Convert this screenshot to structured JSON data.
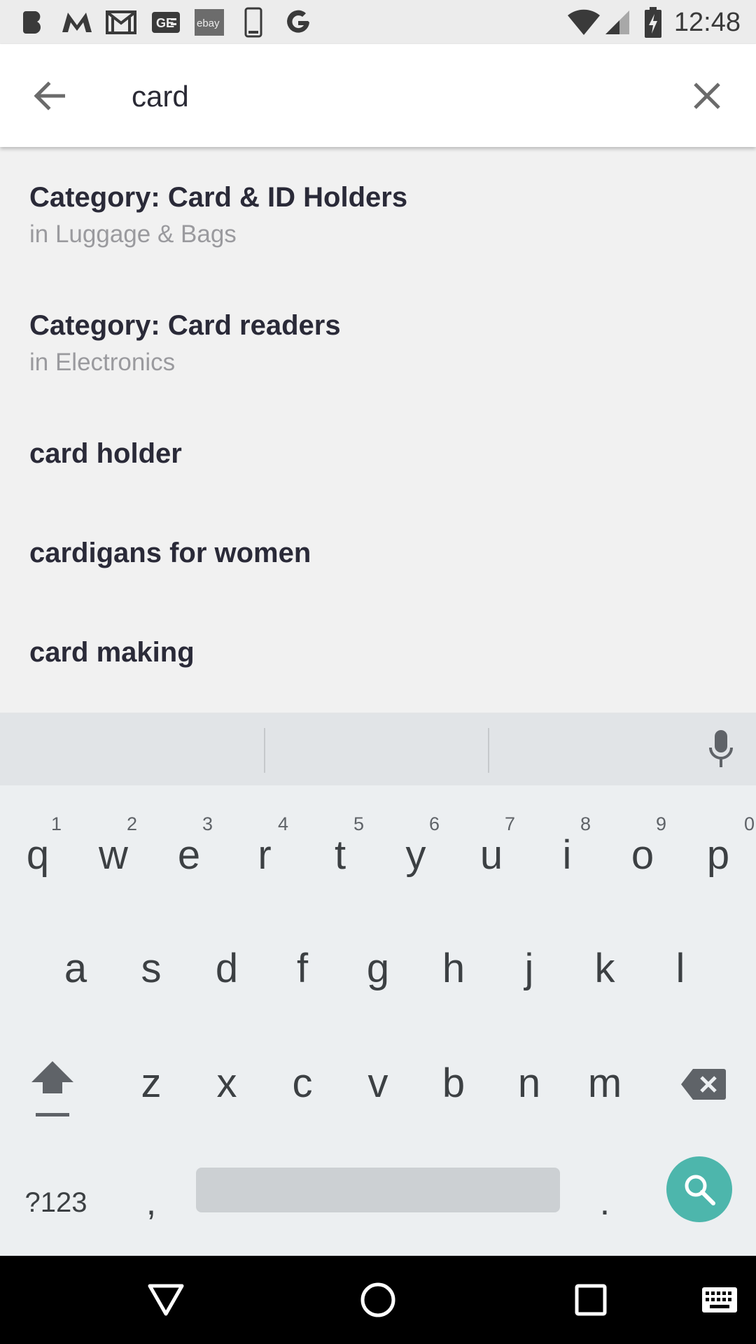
{
  "status_bar": {
    "time": "12:48",
    "left_icons": [
      "b-app-icon",
      "m-app-icon",
      "gmail-icon",
      "news-app-icon",
      "ebay-icon",
      "phone-device-icon",
      "google-icon"
    ],
    "ebay_label": "ebay",
    "ge_label": "GE",
    "right_icons": [
      "wifi-icon",
      "cell-signal-icon",
      "battery-charging-icon"
    ]
  },
  "search": {
    "query": "card"
  },
  "suggestions": [
    {
      "title": "Category: Card & ID Holders",
      "subtitle": "in Luggage & Bags"
    },
    {
      "title": "Category: Card readers",
      "subtitle": "in Electronics"
    },
    {
      "title": "card holder"
    },
    {
      "title": "cardigans for women"
    },
    {
      "title": "card making"
    }
  ],
  "keyboard": {
    "row1": [
      {
        "letter": "q",
        "digit": "1"
      },
      {
        "letter": "w",
        "digit": "2"
      },
      {
        "letter": "e",
        "digit": "3"
      },
      {
        "letter": "r",
        "digit": "4"
      },
      {
        "letter": "t",
        "digit": "5"
      },
      {
        "letter": "y",
        "digit": "6"
      },
      {
        "letter": "u",
        "digit": "7"
      },
      {
        "letter": "i",
        "digit": "8"
      },
      {
        "letter": "o",
        "digit": "9"
      },
      {
        "letter": "p",
        "digit": "0"
      }
    ],
    "row2": [
      "a",
      "s",
      "d",
      "f",
      "g",
      "h",
      "j",
      "k",
      "l"
    ],
    "row3": [
      "z",
      "x",
      "c",
      "v",
      "b",
      "n",
      "m"
    ],
    "symbols_label": "?123",
    "comma_label": ",",
    "period_label": ".",
    "accent_color": "#4db6ac"
  },
  "nav_bar": {
    "icons": [
      "back-triangle-icon",
      "home-circle-icon",
      "recents-square-icon",
      "keyboard-switch-icon"
    ]
  }
}
